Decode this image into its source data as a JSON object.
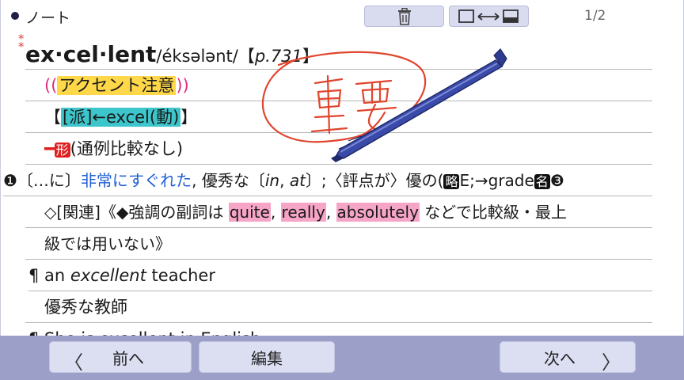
{
  "header": {
    "title": "ノート",
    "trash_icon": "trash-icon",
    "layout_icon": "layout-toggle-icon",
    "page_indicator": "1/2"
  },
  "entry": {
    "headword": "ex·cel·lent",
    "asterisks": "**",
    "pronunciation": "/éksələnt/",
    "page_ref_open": "【",
    "page_ref": "p.731",
    "page_ref_close": "】",
    "lines": {
      "accent_open": "((",
      "accent": "アクセント注意",
      "accent_close": "))",
      "derived_open": "【",
      "derived_tag": "[派]",
      "derived_text": "←excel",
      "derived_pos": "(動)",
      "derived_close": "】",
      "pos_dash": "━",
      "pos_tag": "形",
      "pos_note": "(通例比較なし)",
      "sense_num": "❶",
      "sense_pre": "〔…に〕",
      "sense_main": "非常にすぐれた",
      "sense_rest": ", 優秀な〔",
      "sense_in": "in",
      "sense_comma": ", ",
      "sense_at": "at",
      "sense_rest2": "〕;〈評点が〉優の(",
      "sense_abbr": "略",
      "sense_rest3": "E;→grade",
      "sense_noun": "名",
      "sense_circ": "❸",
      "note_pre": "◇[関連]《◆強調の副詞は ",
      "note_w1": "quite",
      "note_c1": ", ",
      "note_w2": "really",
      "note_c2": ", ",
      "note_w3": "absolutely",
      "note_post": " などで比較級・最上",
      "note_cont": "級では用いない》",
      "ex1_mark": "¶ ",
      "ex1_a": "an ",
      "ex1_b": "excellent",
      "ex1_c": " teacher",
      "ex1_jp": "優秀な教師",
      "ex2_partial": "¶ She is excellent in English."
    }
  },
  "annotation": {
    "handwritten_text": "重要",
    "ink_color": "#e0452e",
    "stylus_color": "#3a4aa8"
  },
  "footer": {
    "prev_label": "前へ",
    "prev_arrow": "〈",
    "edit_label": "編集",
    "next_label": "次へ",
    "next_arrow": "〉"
  },
  "colors": {
    "accent_highlight": "#ffd84a",
    "derived_highlight": "#3cc6cb",
    "emphasis_highlight": "#f7a5c7",
    "blue_text": "#1f5fd6",
    "footer_bg": "#9c9fc7"
  }
}
